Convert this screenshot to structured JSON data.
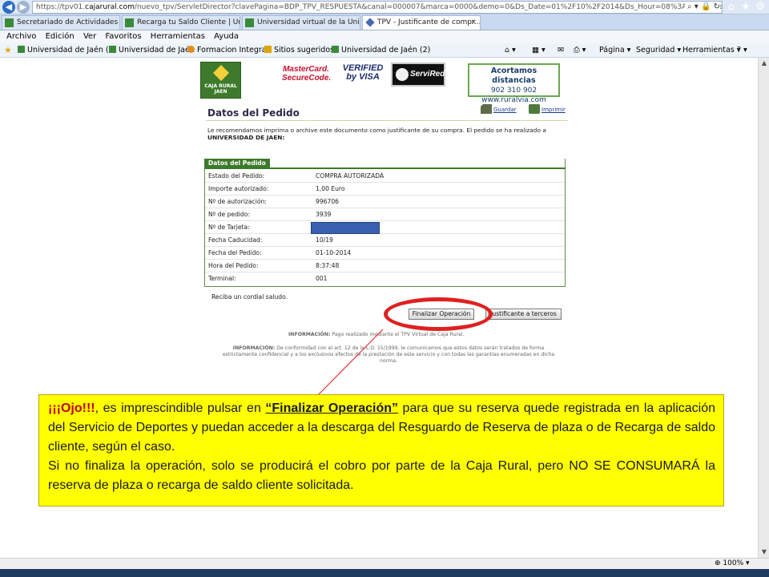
{
  "browser": {
    "url_prefix": "https://tpv01.",
    "url_host": "cajarural.com",
    "url_rest": "/nuevo_tpv/ServletDirector?clavePagina=BDP_TPV_RESPUESTA&canal=000007&marca=0000&demo=0&Ds_Date=01%2F10%2F2014&Ds_Hour=08%3A38&Ds_SecurePa",
    "url_icons": "⌕ ▾ 🔒 ↻",
    "window_controls": [
      "⌂",
      "★",
      "⚙"
    ],
    "tabs": [
      {
        "label": "Secretariado de Actividades Fís..."
      },
      {
        "label": "Recarga tu Saldo Cliente | Univ..."
      },
      {
        "label": "Universidad virtual de la Univer..."
      },
      {
        "label": "TPV - Justificante de compr..."
      }
    ],
    "tab_close": "×",
    "menu": [
      "Archivo",
      "Edición",
      "Ver",
      "Favoritos",
      "Herramientas",
      "Ayuda"
    ],
    "favorites": [
      {
        "label": "Universidad de Jaén (3)"
      },
      {
        "label": "Universidad de Jaén"
      },
      {
        "label": "Formacion Integral"
      },
      {
        "label": "Sitios sugeridos"
      },
      {
        "label": "Universidad de Jaén (2)"
      }
    ],
    "commands": {
      "home": "⌂ ▾",
      "feeds": "▦ ▾",
      "mail": "✉",
      "print": "⎙ ▾",
      "page": "Página ▾",
      "safety": "Seguridad ▾",
      "tools": "Herramientas ▾",
      "help": "? ▾"
    },
    "zoom": "100%"
  },
  "logos": {
    "bank": "CAJA RURAL\nJAEN",
    "mastercard": "MasterCard.\nSecureCode.",
    "visa": "VERIFIED\nby VISA",
    "servired": "ServiRed"
  },
  "contact": {
    "title": "Acortamos distancias",
    "phone": "902 310 902",
    "web": "www.ruralvia.com"
  },
  "page": {
    "title": "Datos del Pedido",
    "save_label": "Guardar",
    "print_label": "Imprimir",
    "intro": "Le recomendamos imprima o archive este documento como justificante de su compra. El pedido se ha realizado a",
    "merchant": "UNIVERSIDAD DE JAEN:",
    "panel_title": "Datos del Pedido",
    "rows": [
      {
        "label": "Estado del Pedido:",
        "value": "COMPRA AUTORIZADA"
      },
      {
        "label": "Importe autorizado:",
        "value": "1,00 Euro"
      },
      {
        "label": "Nº de autorización:",
        "value": "996706"
      },
      {
        "label": "Nº de pedido:",
        "value": "3939"
      },
      {
        "label": "Nº de Tarjeta:",
        "value": ""
      },
      {
        "label": "Fecha Caducidad:",
        "value": "10/19"
      },
      {
        "label": "Fecha del Pedido:",
        "value": "01-10-2014"
      },
      {
        "label": "Hora del Pedido:",
        "value": "8:37:48"
      },
      {
        "label": "Terminal:",
        "value": "001"
      }
    ],
    "greeting": "Reciba un cordial saludo.",
    "btn_finalizar": "Finalizar Operación",
    "btn_justificante": "Justificante a terceros",
    "info_label": "INFORMACIÓN:",
    "info_line": "Pago realizado mediante el TPV Virtual de Caja Rural.",
    "info_para": "De conformidad con el art. 12 de la L.O. 15/1999, le comunicamos que estos datos serán tratados de forma estrictamente confidencial y a los exclusivos efectos de la prestación de este servicio y con todas las garantías enumeradas en dicha norma."
  },
  "callout": {
    "ojo": "¡¡¡Ojo!!!",
    "part1": ", es imprescindible pulsar en ",
    "fin_op": "“Finalizar Operación”",
    "part2": " para que su reserva quede registrada en la aplicación del Servicio de Deportes y puedan acceder a la descarga del Resguardo de Reserva de plaza o de Recarga de saldo cliente, según el caso.",
    "part3": "Si no finaliza la operación, solo se producirá el cobro por parte de la Caja Rural, pero NO SE CONSUMARÁ la reserva de plaza o recarga de saldo cliente solicitada."
  },
  "colors": {
    "callout_bg": "#ffff00",
    "ojo": "#c00000",
    "ellipse": "#e02020",
    "panel_green": "#3c7a2a"
  }
}
